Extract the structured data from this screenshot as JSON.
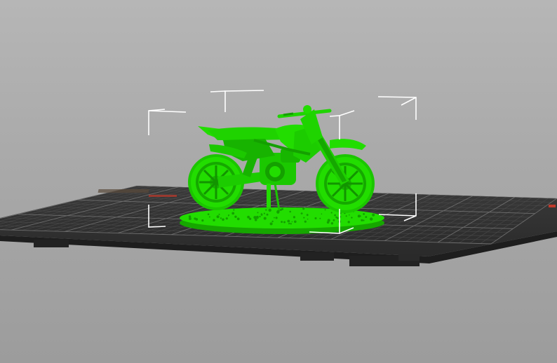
{
  "viewport": {
    "background_top": "#b6b6b6",
    "background_bottom": "#9c9c9c"
  },
  "bed": {
    "surface_color": "#2f2f2f",
    "grid_color": "#4a4a4a",
    "major_grid_color": "#6a6a6a",
    "edge_color": "#202020",
    "label_text": "",
    "marker_color": "#c0392b"
  },
  "model": {
    "name_icon": "motorcycle-model-icon",
    "color": "#22dd00",
    "shade_color": "#16a600",
    "highlight_color": "#6cff4a"
  },
  "bounding_box": {
    "color": "#ffffff"
  }
}
